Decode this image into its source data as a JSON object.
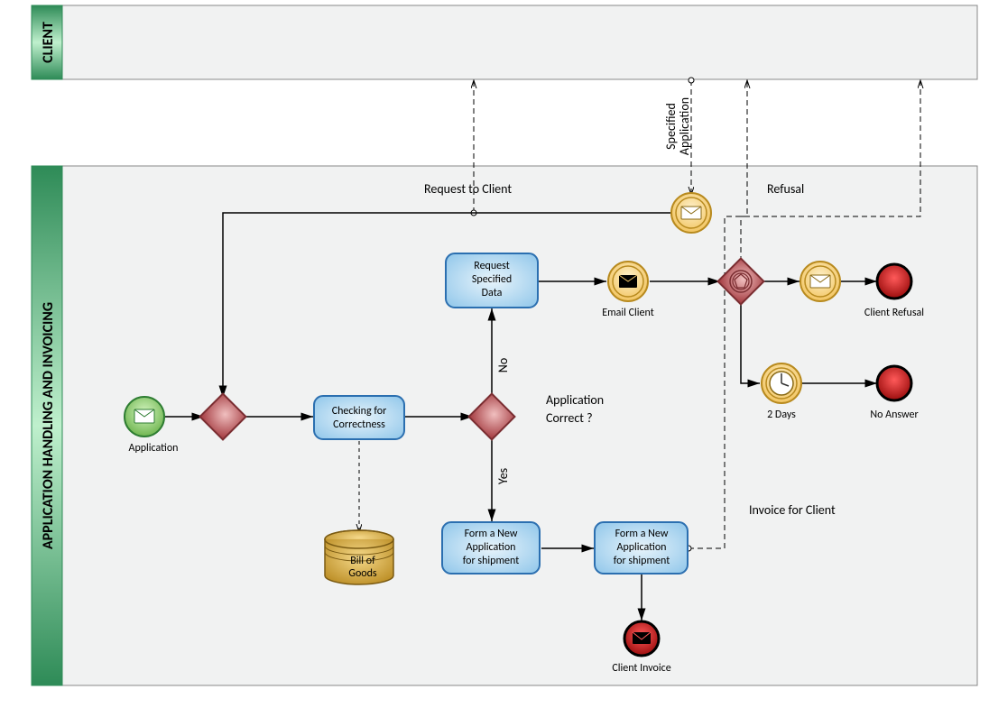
{
  "pools": {
    "client": "CLIENT",
    "app": "APPLICATION HANDLING AND INVOICING"
  },
  "nodes": {
    "start": "Application",
    "check": {
      "l1": "Checking for",
      "l2": "Correctness"
    },
    "bill": {
      "l1": "Bill of",
      "l2": "Goods"
    },
    "request": {
      "l1": "Request",
      "l2": "Specified",
      "l3": "Data"
    },
    "email": "Email Client",
    "form1": {
      "l1": "Form a New",
      "l2": "Application",
      "l3": "for shipment"
    },
    "form2": {
      "l1": "Form a New",
      "l2": "Application",
      "l3": "for shipment"
    },
    "invoiceEnd": "Client Invoice",
    "refusalEnd": "Client Refusal",
    "noAnswerEnd": "No Answer",
    "timer": "2 Days"
  },
  "edges": {
    "requestClient": "Request to Client",
    "refusal": "Refusal",
    "specApp": {
      "l1": "Specified",
      "l2": "Application"
    },
    "invoiceClient": "Invoice for Client",
    "appCorrect": "Application Correct ?",
    "yes": "Yes",
    "no": "No"
  },
  "colors": {
    "poolGreen1": "#2e8b57",
    "poolGreen2": "#a8e0b8",
    "poolFill": "#f1f2f2",
    "task1": "#d6eefc",
    "task2": "#8fc6ea",
    "taskBorder": "#2b6fb0",
    "gateway1": "#e9a3a3",
    "gateway2": "#b4474d",
    "start1": "#b7e89a",
    "start2": "#6bbf4a",
    "yellow1": "#fde9b5",
    "yellow2": "#f4c96a",
    "gold1": "#f2cf6f",
    "gold2": "#c49528",
    "end1": "#ff3b3b",
    "end2": "#9b0000"
  }
}
